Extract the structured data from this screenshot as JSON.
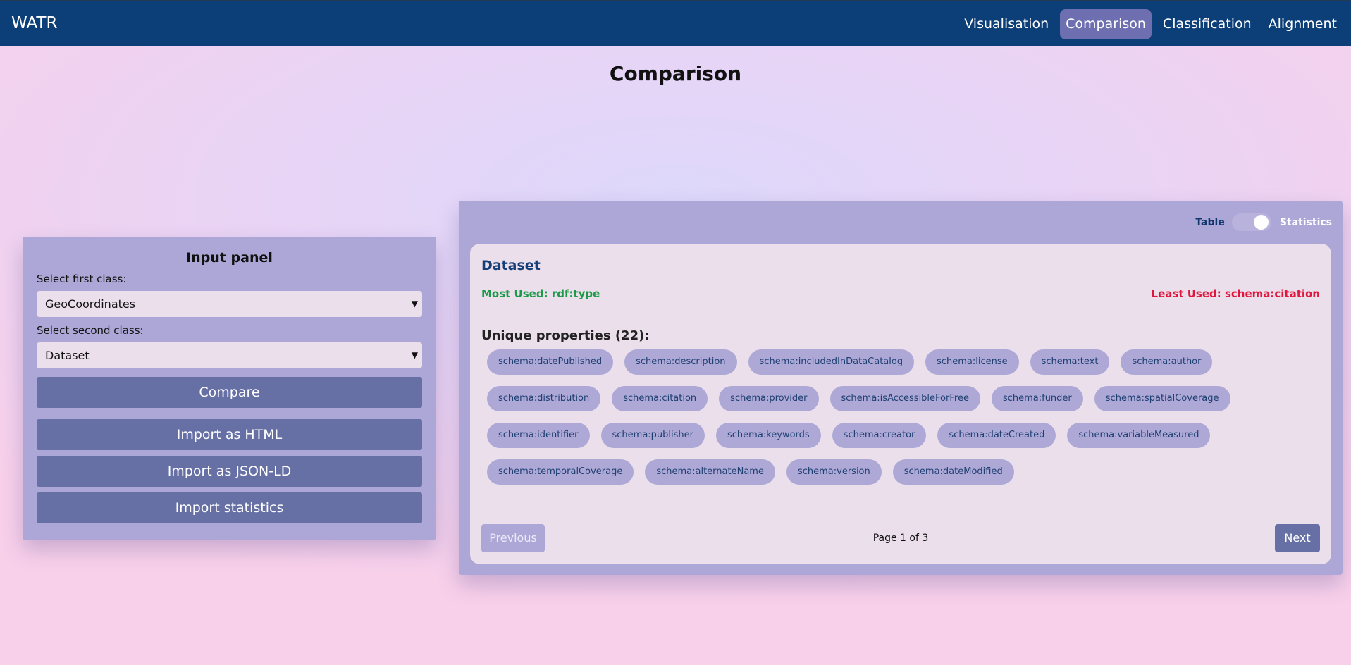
{
  "app": {
    "brand": "WATR",
    "nav": [
      "Visualisation",
      "Comparison",
      "Classification",
      "Alignment"
    ],
    "active_nav": "Comparison"
  },
  "page": {
    "title": "Comparison"
  },
  "input_panel": {
    "title": "Input panel",
    "first_label": "Select first class:",
    "first_value": "GeoCoordinates",
    "second_label": "Select second class:",
    "second_value": "Dataset",
    "compare_label": "Compare",
    "import_html_label": "Import as HTML",
    "import_jsonld_label": "Import as JSON-LD",
    "import_stats_label": "Import statistics"
  },
  "results": {
    "toggle_left": "Table",
    "toggle_right": "Statistics",
    "class_name": "Dataset",
    "most_used": "Most Used: rdf:type",
    "least_used": "Least Used: schema:citation",
    "unique_title": "Unique properties (22):",
    "properties": [
      "schema:datePublished",
      "schema:description",
      "schema:includedInDataCatalog",
      "schema:license",
      "schema:text",
      "schema:author",
      "schema:distribution",
      "schema:citation",
      "schema:provider",
      "schema:isAccessibleForFree",
      "schema:funder",
      "schema:spatialCoverage",
      "schema:identifier",
      "schema:publisher",
      "schema:keywords",
      "schema:creator",
      "schema:dateCreated",
      "schema:variableMeasured",
      "schema:temporalCoverage",
      "schema:alternateName",
      "schema:version",
      "schema:dateModified"
    ],
    "previous_label": "Previous",
    "page_info": "Page 1 of 3",
    "next_label": "Next"
  }
}
